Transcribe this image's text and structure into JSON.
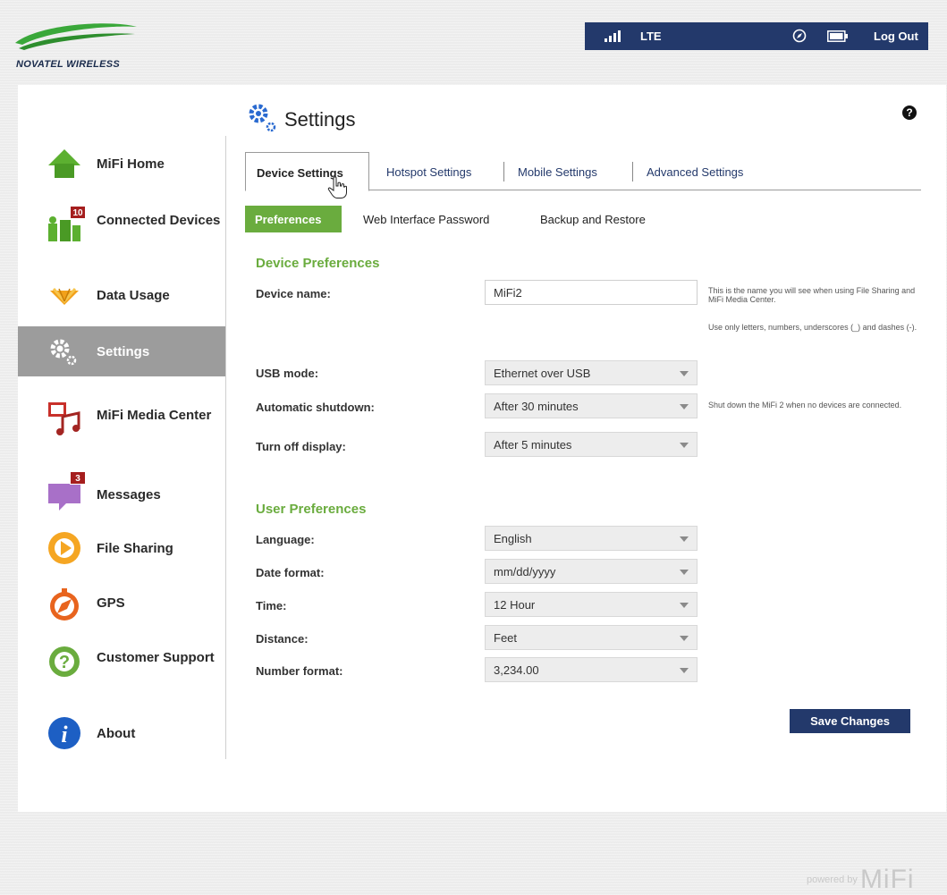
{
  "header": {
    "logo_text": "NOVATEL WIRELESS",
    "network": "LTE",
    "logout_label": "Log Out",
    "icons": [
      "signal-icon",
      "gps-compass-icon",
      "battery-icon"
    ]
  },
  "sidebar": {
    "items": [
      {
        "label": "MiFi Home",
        "icon": "home-icon"
      },
      {
        "label": "Connected Devices",
        "icon": "connected-devices-icon",
        "badge": "10"
      },
      {
        "label": "Data Usage",
        "icon": "data-usage-icon"
      },
      {
        "label": "Settings",
        "icon": "gear-icon",
        "active": true
      },
      {
        "label": "MiFi Media Center",
        "icon": "media-center-icon"
      },
      {
        "label": "Messages",
        "icon": "messages-icon",
        "badge": "3"
      },
      {
        "label": "File Sharing",
        "icon": "file-sharing-icon"
      },
      {
        "label": "GPS",
        "icon": "gps-icon"
      },
      {
        "label": "Customer Support",
        "icon": "support-icon"
      },
      {
        "label": "About",
        "icon": "info-icon"
      }
    ]
  },
  "page": {
    "title": "Settings",
    "help": "?"
  },
  "tabs": [
    {
      "label": "Device Settings",
      "active": true
    },
    {
      "label": "Hotspot Settings"
    },
    {
      "label": "Mobile Settings"
    },
    {
      "label": "Advanced Settings"
    }
  ],
  "subtabs": [
    {
      "label": "Preferences",
      "active": true
    },
    {
      "label": "Web Interface Password"
    },
    {
      "label": "Backup and Restore"
    }
  ],
  "device_prefs": {
    "title": "Device Preferences",
    "device_name": {
      "label": "Device name:",
      "value": "MiFi2"
    },
    "device_name_hint_1": "This is the name you will see when using File Sharing and MiFi Media Center.",
    "device_name_hint_2": "Use only letters, numbers, underscores (_) and dashes (-).",
    "usb_mode": {
      "label": "USB mode:",
      "value": "Ethernet over USB"
    },
    "auto_shutdown": {
      "label": "Automatic shutdown:",
      "value": "After 30 minutes"
    },
    "auto_shutdown_hint": "Shut down the MiFi 2 when no devices are connected.",
    "display_off": {
      "label": "Turn off display:",
      "value": "After 5 minutes"
    }
  },
  "user_prefs": {
    "title": "User Preferences",
    "language": {
      "label": "Language:",
      "value": "English"
    },
    "date_format": {
      "label": "Date format:",
      "value": "mm/dd/yyyy"
    },
    "time": {
      "label": "Time:",
      "value": "12 Hour"
    },
    "distance": {
      "label": "Distance:",
      "value": "Feet"
    },
    "number_format": {
      "label": "Number format:",
      "value": "3,234.00"
    }
  },
  "actions": {
    "save_label": "Save Changes"
  },
  "footer": {
    "powered_by": "powered by",
    "brand": "MiFi"
  },
  "colors": {
    "navy": "#23396b",
    "green": "#6aac3e",
    "active_nav": "#9c9c9c"
  }
}
